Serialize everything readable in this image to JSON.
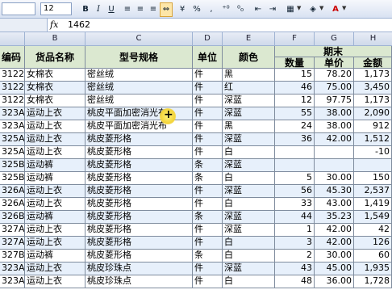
{
  "toolbar": {
    "font_size": "12",
    "bold": "B",
    "italic": "I",
    "underline": "U",
    "percent": "%",
    "comma": ",",
    "inc_dec": "⁺⁰",
    "dec_dec": "⁰₀",
    "indent_dec": "⇤",
    "indent_inc": "⇥",
    "font_color_label": "A"
  },
  "formula_bar": {
    "fx": "fx",
    "value": "1462"
  },
  "columns": [
    "B",
    "C",
    "D",
    "E",
    "F",
    "G",
    "H"
  ],
  "headers": {
    "code": "编码",
    "name": "货品名称",
    "model": "型号规格",
    "unit": "单位",
    "color": "颜色",
    "period_end": "期末",
    "qty": "数量",
    "price": "单价",
    "amount": "金额"
  },
  "rows": [
    {
      "code": "3122",
      "name": "女棉衣",
      "model": "密丝绒",
      "unit": "件",
      "color": "黑",
      "qty": "15",
      "price": "78.20",
      "amount": "1,173"
    },
    {
      "code": "3122",
      "name": "女棉衣",
      "model": "密丝绒",
      "unit": "件",
      "color": "红",
      "qty": "46",
      "price": "75.00",
      "amount": "3,450"
    },
    {
      "code": "3122",
      "name": "女棉衣",
      "model": "密丝绒",
      "unit": "件",
      "color": "深蓝",
      "qty": "12",
      "price": "97.75",
      "amount": "1,173"
    },
    {
      "code": "323A",
      "name": "运动上衣",
      "model": "桃皮平面加密消光布",
      "unit": "件",
      "color": "深蓝",
      "qty": "55",
      "price": "38.00",
      "amount": "2,090"
    },
    {
      "code": "323A",
      "name": "运动上衣",
      "model": "桃皮平面加密消光布",
      "unit": "件",
      "color": "黑",
      "qty": "24",
      "price": "38.00",
      "amount": "912"
    },
    {
      "code": "325A",
      "name": "运动上衣",
      "model": "桃皮菱形格",
      "unit": "件",
      "color": "深蓝",
      "qty": "36",
      "price": "42.00",
      "amount": "1,512"
    },
    {
      "code": "325A",
      "name": "运动上衣",
      "model": "桃皮菱形格",
      "unit": "件",
      "color": "白",
      "qty": "",
      "price": "",
      "amount": "-10"
    },
    {
      "code": "325B",
      "name": "运动裤",
      "model": "桃皮菱形格",
      "unit": "条",
      "color": "深蓝",
      "qty": "",
      "price": "",
      "amount": ""
    },
    {
      "code": "325B",
      "name": "运动裤",
      "model": "桃皮菱形格",
      "unit": "条",
      "color": "白",
      "qty": "5",
      "price": "30.00",
      "amount": "150"
    },
    {
      "code": "326A",
      "name": "运动上衣",
      "model": "桃皮菱形格",
      "unit": "件",
      "color": "深蓝",
      "qty": "56",
      "price": "45.30",
      "amount": "2,537"
    },
    {
      "code": "326A",
      "name": "运动上衣",
      "model": "桃皮菱形格",
      "unit": "件",
      "color": "白",
      "qty": "33",
      "price": "43.00",
      "amount": "1,419"
    },
    {
      "code": "326B",
      "name": "运动裤",
      "model": "桃皮菱形格",
      "unit": "条",
      "color": "深蓝",
      "qty": "44",
      "price": "35.23",
      "amount": "1,549"
    },
    {
      "code": "327A",
      "name": "运动上衣",
      "model": "桃皮菱形格",
      "unit": "件",
      "color": "深蓝",
      "qty": "1",
      "price": "42.00",
      "amount": "42"
    },
    {
      "code": "327A",
      "name": "运动上衣",
      "model": "桃皮菱形格",
      "unit": "件",
      "color": "白",
      "qty": "3",
      "price": "42.00",
      "amount": "126"
    },
    {
      "code": "327B",
      "name": "运动裤",
      "model": "桃皮菱形格",
      "unit": "条",
      "color": "白",
      "qty": "2",
      "price": "30.00",
      "amount": "60"
    },
    {
      "code": "323A",
      "name": "运动上衣",
      "model": "桃皮珍珠点",
      "unit": "件",
      "color": "深蓝",
      "qty": "43",
      "price": "45.00",
      "amount": "1,935"
    },
    {
      "code": "323A",
      "name": "运动上衣",
      "model": "桃皮珍珠点",
      "unit": "件",
      "color": "白",
      "qty": "48",
      "price": "36.00",
      "amount": "1,728"
    }
  ]
}
